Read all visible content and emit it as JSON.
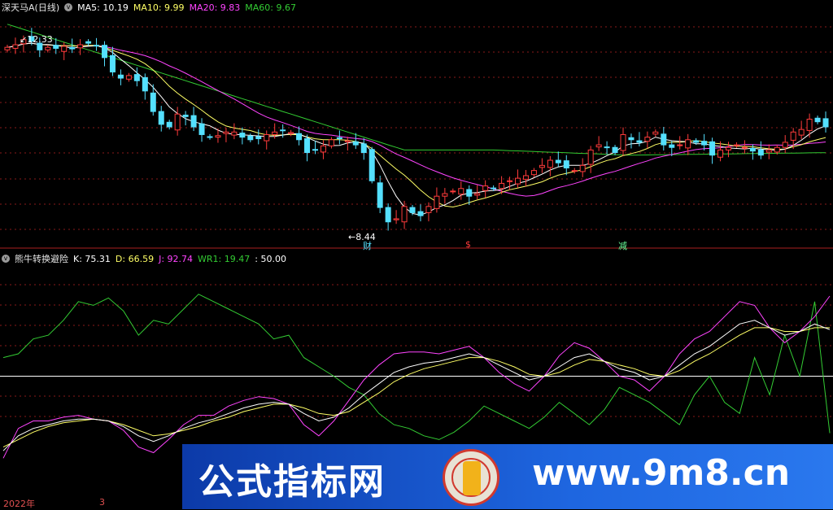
{
  "colors": {
    "up": "#ff3b3b",
    "down": "#54e0ff",
    "ma5": "#ffffff",
    "ma10": "#ffff66",
    "ma20": "#ff44ff",
    "ma60": "#33cc33",
    "grid": "#8a1a1a",
    "k": "#ffffff",
    "d": "#ffff66",
    "j": "#ff44ff",
    "wr1": "#33cc33",
    "mid": "#ffffff"
  },
  "price_legend": {
    "stock": "深天马A",
    "period": "(日线)",
    "ma5": "MA5: 10.19",
    "ma10": "MA10: 9.99",
    "ma20": "MA20: 9.83",
    "ma60": "MA60: 9.67"
  },
  "indicator_legend": {
    "name": "熊牛转换避险",
    "k": "K: 75.31",
    "d": "D: 66.59",
    "j": "J: 92.74",
    "wr1": "WR1: 19.47",
    "mid": ": 50.00"
  },
  "annotations": {
    "high": "12.33",
    "low": "8.44",
    "sig1": "财",
    "sig2": "$",
    "sig3": "减"
  },
  "axis": {
    "year": "2022年",
    "month": "3"
  },
  "watermark": {
    "left": "公式指标网",
    "right": "www.9m8.cn"
  },
  "chart_data": [
    {
      "type": "candlestick",
      "title": "深天马A (日线)",
      "ylim": [
        8.1,
        12.6
      ],
      "close": [
        11.9,
        11.95,
        12.05,
        12.02,
        11.85,
        11.9,
        11.88,
        11.92,
        11.87,
        11.95,
        11.98,
        11.94,
        11.7,
        11.42,
        11.3,
        11.35,
        11.25,
        11.05,
        10.65,
        10.4,
        10.35,
        10.6,
        10.55,
        10.35,
        10.2,
        10.15,
        10.18,
        10.25,
        10.25,
        10.15,
        10.1,
        10.12,
        10.2,
        10.25,
        10.28,
        10.24,
        10.1,
        9.85,
        9.9,
        9.98,
        10.1,
        10.12,
        10.08,
        10.0,
        9.85,
        9.3,
        8.78,
        8.5,
        8.56,
        8.8,
        8.68,
        8.62,
        8.8,
        9.0,
        9.05,
        9.1,
        9.15,
        9.0,
        9.05,
        9.2,
        9.15,
        9.25,
        9.3,
        9.35,
        9.4,
        9.5,
        9.6,
        9.7,
        9.65,
        9.55,
        9.5,
        9.6,
        9.9,
        10.0,
        9.95,
        9.85,
        10.2,
        10.1,
        10.05,
        10.15,
        10.25,
        10.0,
        9.95,
        10.0,
        10.1,
        10.05,
        10.0,
        9.8,
        9.9,
        9.95,
        10.0,
        9.95,
        9.88,
        9.8,
        9.9,
        9.95,
        10.05,
        10.25,
        10.3,
        10.5,
        10.45,
        10.35
      ]
    },
    {
      "type": "line",
      "title": "熊牛转换避险",
      "ylim": [
        -10,
        110
      ],
      "k": [
        10,
        18,
        22,
        24,
        26,
        27,
        27,
        26,
        23,
        18,
        15,
        18,
        22,
        25,
        27,
        30,
        33,
        35,
        36,
        35,
        30,
        26,
        28,
        33,
        40,
        46,
        52,
        55,
        57,
        58,
        60,
        62,
        60,
        56,
        52,
        48,
        50,
        55,
        60,
        62,
        58,
        54,
        52,
        48,
        50,
        56,
        62,
        66,
        72,
        78,
        80,
        76,
        72,
        74,
        78,
        75
      ],
      "d": [
        12,
        16,
        20,
        23,
        25,
        26,
        27,
        26,
        24,
        21,
        18,
        19,
        21,
        23,
        26,
        28,
        31,
        33,
        35,
        35,
        33,
        30,
        29,
        31,
        36,
        41,
        47,
        51,
        54,
        56,
        58,
        60,
        60,
        58,
        55,
        51,
        50,
        52,
        56,
        59,
        58,
        56,
        54,
        51,
        50,
        53,
        58,
        62,
        67,
        72,
        76,
        76,
        74,
        74,
        76,
        76
      ],
      "j": [
        6,
        22,
        26,
        26,
        28,
        29,
        27,
        26,
        21,
        12,
        9,
        16,
        24,
        29,
        29,
        34,
        37,
        39,
        38,
        35,
        24,
        18,
        26,
        37,
        48,
        56,
        62,
        63,
        63,
        62,
        64,
        66,
        60,
        52,
        46,
        42,
        50,
        61,
        68,
        65,
        58,
        50,
        48,
        42,
        50,
        62,
        70,
        74,
        82,
        90,
        88,
        76,
        68,
        74,
        82,
        93
      ],
      "wr1": [
        60,
        62,
        70,
        72,
        80,
        90,
        88,
        92,
        85,
        72,
        80,
        78,
        86,
        94,
        90,
        86,
        82,
        78,
        70,
        72,
        60,
        55,
        50,
        44,
        40,
        30,
        24,
        22,
        18,
        16,
        20,
        26,
        34,
        30,
        26,
        22,
        28,
        36,
        30,
        24,
        32,
        44,
        40,
        36,
        30,
        24,
        40,
        50,
        36,
        30,
        60,
        40,
        72,
        50,
        90,
        19.47
      ],
      "mid": 50
    }
  ]
}
